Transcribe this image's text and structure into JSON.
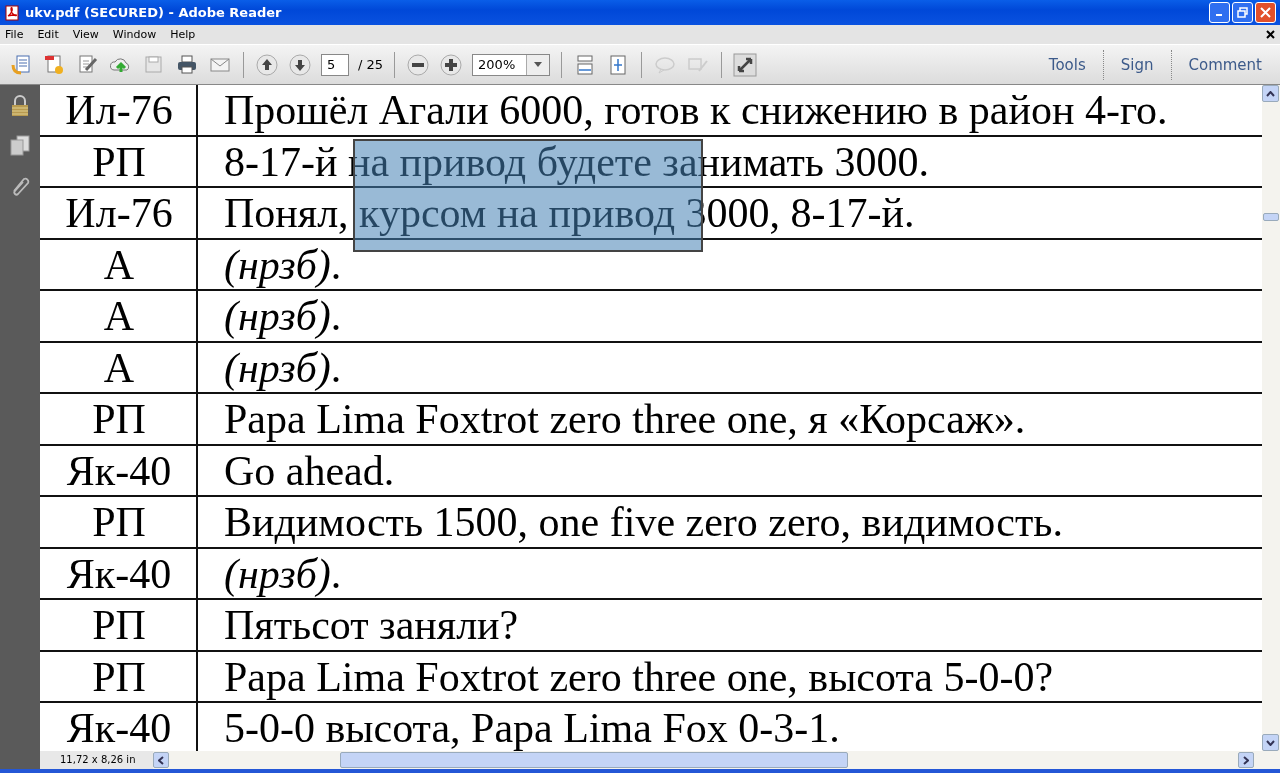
{
  "window": {
    "title": "ukv.pdf (SECURED) - Adobe Reader"
  },
  "menu": [
    "File",
    "Edit",
    "View",
    "Window",
    "Help"
  ],
  "toolbar": {
    "page": "5",
    "page_total": "/ 25",
    "zoom": "200%",
    "links": [
      "Tools",
      "Sign",
      "Comment"
    ]
  },
  "marquee_selection": true,
  "rows": [
    {
      "speaker": "Ил-76",
      "text": "Прошёл Агали 6000, готов к снижению в район 4-го."
    },
    {
      "speaker": "РП",
      "text": "8-17-й на привод будете занимать 3000."
    },
    {
      "speaker": "Ил-76",
      "text": "Понял, курсом на привод 3000, 8-17-й."
    },
    {
      "speaker": "А",
      "text": "*(нрзб)*."
    },
    {
      "speaker": "А",
      "text": "*(нрзб)*."
    },
    {
      "speaker": "А",
      "text": "*(нрзб)*."
    },
    {
      "speaker": "РП",
      "text": "Papa Lima Foxtrot zero three one, я «Корсаж»."
    },
    {
      "speaker": "Як-40",
      "text": "Go ahead."
    },
    {
      "speaker": "РП",
      "text": "Видимость 1500, one five zero zero, видимость."
    },
    {
      "speaker": "Як-40",
      "text": "*(нрзб)*."
    },
    {
      "speaker": "РП",
      "text": "Пятьсот заняли?"
    },
    {
      "speaker": "РП",
      "text": "Papa Lima Foxtrot zero three one, высота 5-0-0?"
    },
    {
      "speaker": "Як-40",
      "text": "5-0-0 высота, Papa Lima Fox 0-3-1."
    }
  ],
  "status_bar": {
    "page_size": "11,72 x 8,26 in"
  }
}
